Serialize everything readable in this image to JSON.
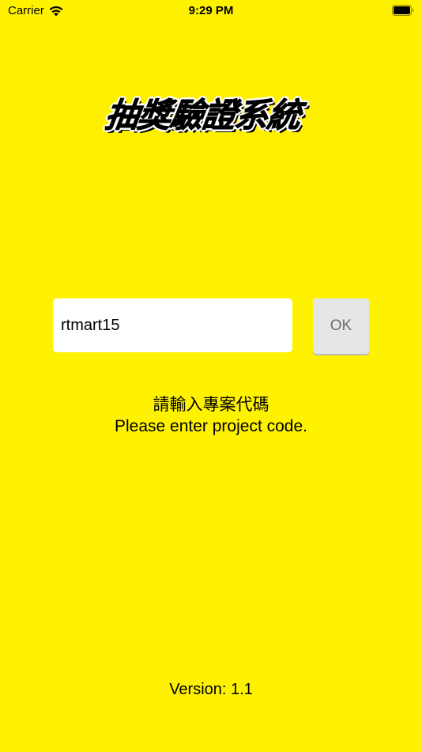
{
  "status_bar": {
    "carrier": "Carrier",
    "time": "9:29 PM",
    "wifi_icon": "wifi-icon",
    "battery_icon": "battery-full-icon"
  },
  "logo": {
    "text": "抽獎驗證系統"
  },
  "form": {
    "project_code_value": "rtmart15",
    "ok_label": "OK"
  },
  "prompt": {
    "chinese": "請輸入專案代碼",
    "english": "Please enter project code."
  },
  "footer": {
    "version": "Version: 1.1"
  },
  "colors": {
    "background": "#FFF200",
    "input_background": "#FFFFFF",
    "button_background": "#E6E6E6",
    "button_text": "#6D6D6D"
  }
}
